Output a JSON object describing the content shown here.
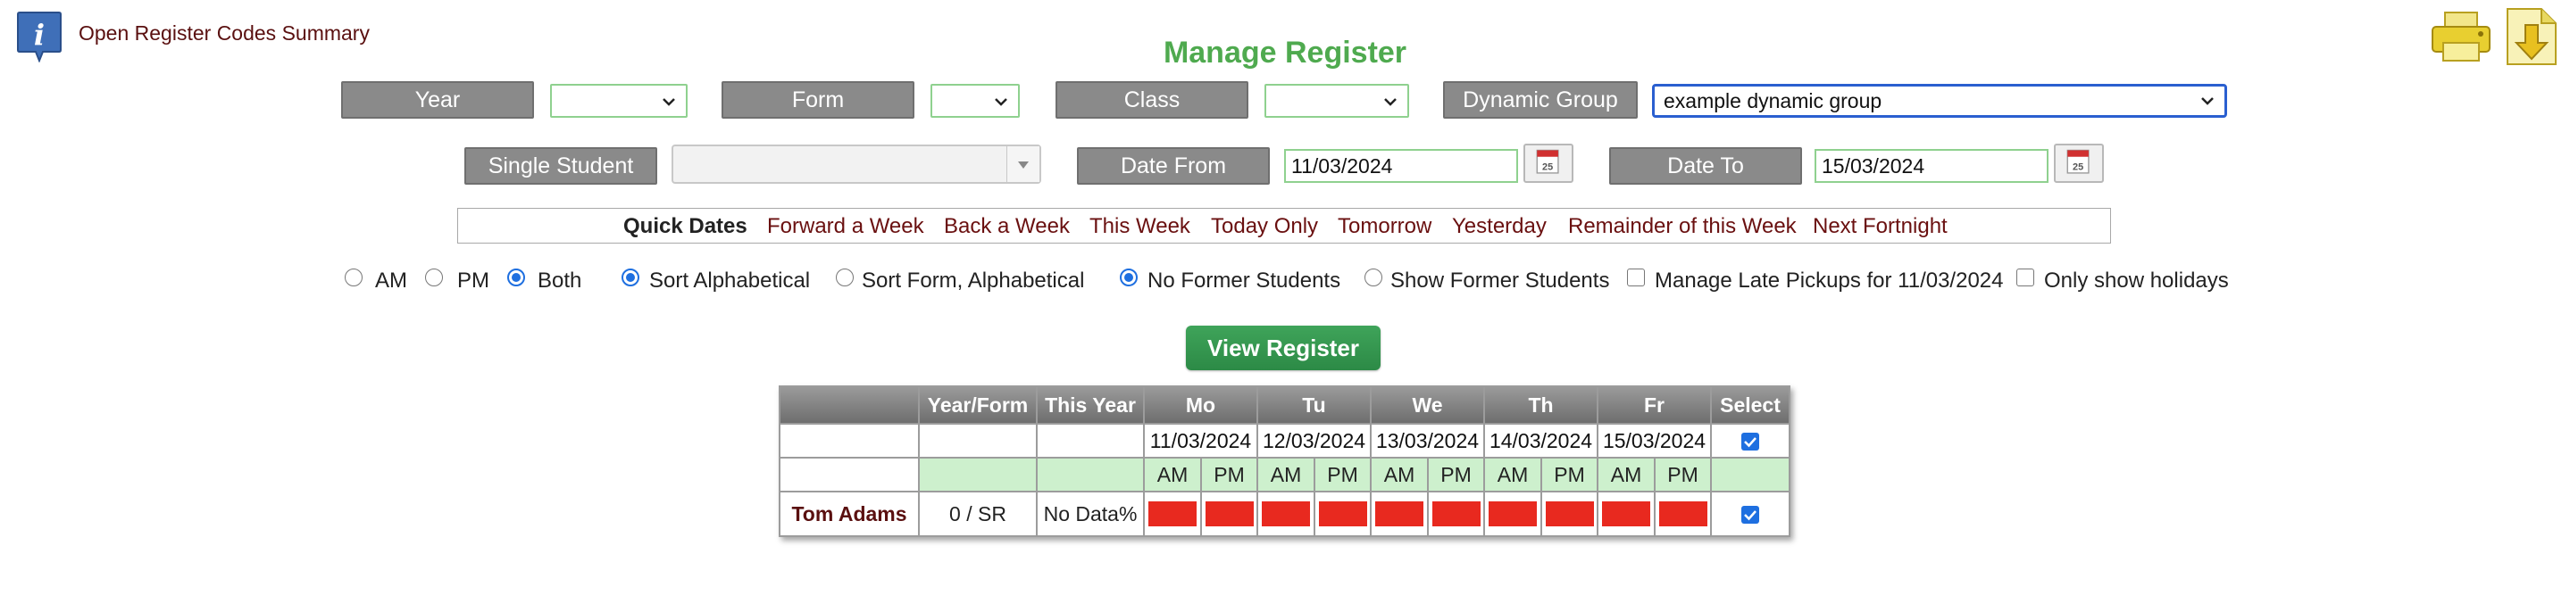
{
  "header": {
    "info_link": "Open Register Codes Summary",
    "title": "Manage Register"
  },
  "filters": {
    "year_label": "Year",
    "year_value": "",
    "form_label": "Form",
    "form_value": "",
    "class_label": "Class",
    "class_value": "",
    "dynamic_group_label": "Dynamic Group",
    "dynamic_group_value": "example dynamic group",
    "single_student_label": "Single Student",
    "single_student_value": "",
    "date_from_label": "Date From",
    "date_from_value": "11/03/2024",
    "date_to_label": "Date To",
    "date_to_value": "15/03/2024",
    "calendar_icon_text": "25"
  },
  "quick_dates": {
    "label": "Quick Dates",
    "links": [
      "Forward a Week",
      "Back a Week",
      "This Week",
      "Today Only",
      "Tomorrow",
      "Yesterday",
      "Remainder of this Week",
      "Next Fortnight"
    ]
  },
  "options": {
    "am": "AM",
    "pm": "PM",
    "both": "Both",
    "sort_alpha": "Sort Alphabetical",
    "sort_form": "Sort Form, Alphabetical",
    "no_former": "No Former Students",
    "show_former": "Show Former Students",
    "late_pickups": "Manage Late Pickups for 11/03/2024",
    "only_holidays": "Only show holidays"
  },
  "view_button": "View Register",
  "table": {
    "headers": [
      "",
      "Year/Form",
      "This Year",
      "Mo",
      "Tu",
      "We",
      "Th",
      "Fr",
      "Select"
    ],
    "dates": [
      "11/03/2024",
      "12/03/2024",
      "13/03/2024",
      "14/03/2024",
      "15/03/2024"
    ],
    "sessions": [
      "AM",
      "PM"
    ],
    "students": [
      {
        "name": "Tom Adams",
        "year_form": "0 / SR",
        "this_year": "No Data%"
      }
    ]
  },
  "colors": {
    "title_green": "#4faa4f",
    "link_maroon": "#6a1010",
    "label_grey": "#8a8a8a",
    "accent_blue": "#1e6fe0",
    "absent_red": "#e8291f",
    "session_green": "#cdf0cd",
    "button_green": "#3fa45a"
  },
  "icons": [
    "info-icon",
    "printer-icon",
    "download-icon",
    "calendar-icon",
    "chevron-down-icon"
  ]
}
